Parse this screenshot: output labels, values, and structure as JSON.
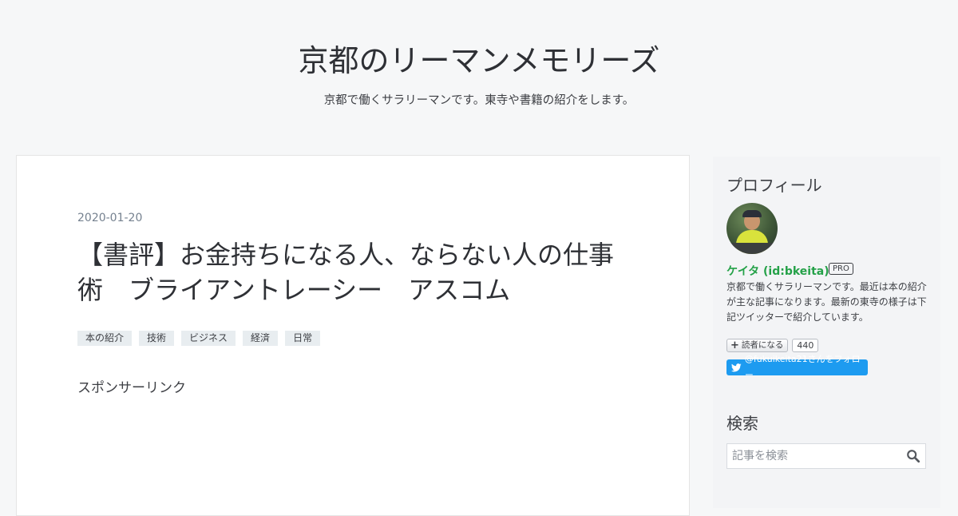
{
  "header": {
    "blog_title": "京都のリーマンメモリーズ",
    "blog_description": "京都で働くサラリーマンです。東寺や書籍の紹介をします。"
  },
  "entry": {
    "date": "2020-01-20",
    "title": "【書評】お金持ちになる人、ならない人の仕事術　ブライアントレーシー　アスコム",
    "categories": [
      "本の紹介",
      "技術",
      "ビジネス",
      "経済",
      "日常"
    ],
    "sponsor_label": "スポンサーリンク"
  },
  "sidebar": {
    "profile": {
      "heading": "プロフィール",
      "name": "ケイタ (id:bkeita)",
      "badge": "PRO",
      "description": "京都で働くサラリーマンです。最近は本の紹介が主な記事になります。最新の東寺の様子は下記ツイッターで紹介しています。",
      "reader_button_label": "読者になる",
      "reader_count": "440",
      "twitter_follow_label": "@fukuikeita21さんをフォロー"
    },
    "search": {
      "heading": "検索",
      "placeholder": "記事を検索"
    }
  },
  "colors": {
    "background": "#f6f7f8",
    "card": "#ffffff",
    "profile_name": "#24a148",
    "twitter_blue": "#1d9bf0",
    "category_tag": "#e8edf0",
    "date": "#75818f"
  },
  "icons": {
    "reader_plus": "plus-icon",
    "twitter": "twitter-bird-icon",
    "search": "search-icon"
  }
}
